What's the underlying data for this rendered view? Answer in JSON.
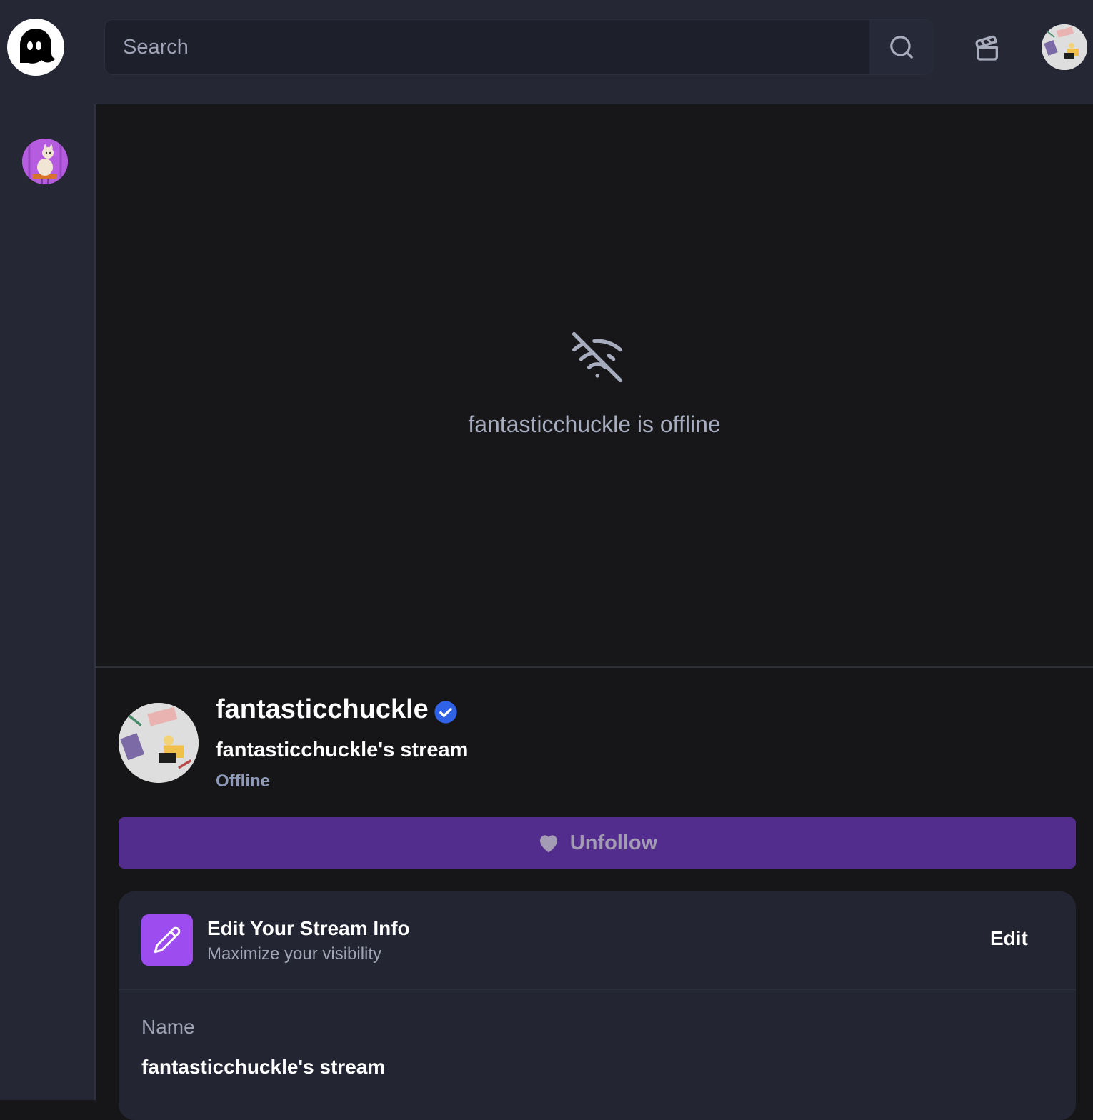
{
  "header": {
    "search": {
      "placeholder": "Search",
      "value": ""
    }
  },
  "icons": {
    "logo": "ghost-logo-icon",
    "search": "search-icon",
    "clapper": "clapperboard-icon",
    "offline": "wifi-off-icon",
    "verified": "verified-check-icon",
    "heart": "heart-icon",
    "pencil": "pencil-icon"
  },
  "player": {
    "offline_message": "fantasticchuckle is offline"
  },
  "channel": {
    "name": "fantasticchuckle",
    "stream_title": "fantasticchuckle's stream",
    "status": "Offline",
    "unfollow_label": "Unfollow"
  },
  "stream_info_card": {
    "title": "Edit Your Stream Info",
    "subtitle": "Maximize your visibility",
    "edit_label": "Edit",
    "fields": [
      {
        "label": "Name",
        "value": "fantasticchuckle's stream"
      }
    ]
  },
  "colors": {
    "topbar": "#252735",
    "player_bg": "#171719",
    "accent_purple": "#9d4cef",
    "unfollow_bg": "#522d8e",
    "verified_blue": "#2f62e6",
    "muted_text": "#a7adbe"
  }
}
